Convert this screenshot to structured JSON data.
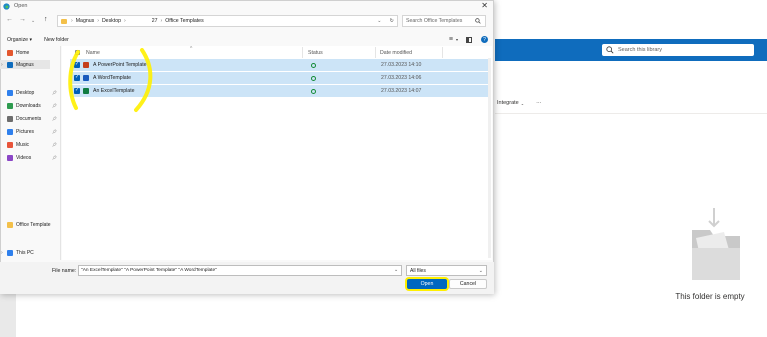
{
  "background": {
    "search_placeholder": "Search this library",
    "command_integrate": "Integrate",
    "command_more": "···",
    "empty_text": "This folder is empty"
  },
  "dialog": {
    "title": "Open",
    "close_glyph": "✕",
    "breadcrumb": [
      "Magnus",
      "Desktop",
      "27",
      "Office Templates"
    ],
    "search_placeholder": "Search Office Templates",
    "toolbar": {
      "organize": "Organize ▾",
      "new_folder": "New folder"
    },
    "nav_items": [
      {
        "label": "Home",
        "icon": "home-icon",
        "color": "#e4572e"
      },
      {
        "label": "Magnus",
        "icon": "onedrive-icon",
        "color": "#0f6cbd"
      },
      {
        "label": "Desktop",
        "icon": "desktop-icon",
        "color": "#2f80ed"
      },
      {
        "label": "Downloads",
        "icon": "download-icon",
        "color": "#2e9b4f"
      },
      {
        "label": "Documents",
        "icon": "documents-icon",
        "color": "#6d6d6d"
      },
      {
        "label": "Pictures",
        "icon": "pictures-icon",
        "color": "#2f80ed"
      },
      {
        "label": "Music",
        "icon": "music-icon",
        "color": "#e8543a"
      },
      {
        "label": "Videos",
        "icon": "videos-icon",
        "color": "#8b46c6"
      },
      {
        "label": "Office Template",
        "icon": "folder-icon",
        "color": "#f3c04a"
      },
      {
        "label": "This PC",
        "icon": "pc-icon",
        "color": "#2f80ed"
      }
    ],
    "columns": {
      "name": "Name",
      "status": "Status",
      "date": "Date modified"
    },
    "files": [
      {
        "name": "A PowerPoint Template",
        "icon": "powerpoint-icon",
        "color": "#c43e1c",
        "date": "27.03.2023 14:10"
      },
      {
        "name": "A WordTemplate",
        "icon": "word-icon",
        "color": "#185abd",
        "date": "27.03.2023 14:06"
      },
      {
        "name": "An ExcelTemplate",
        "icon": "excel-icon",
        "color": "#107c41",
        "date": "27.03.2023 14:07"
      }
    ],
    "file_name_label": "File name:",
    "file_name_value": "\"An ExcelTemplate\" \"A PowerPoint Template\" \"A WordTemplate\"",
    "file_type": "All files",
    "open_label": "Open",
    "cancel_label": "Cancel"
  },
  "colors": {
    "accent": "#0067c0",
    "selection": "#cce4f7",
    "highlight": "#ffef00"
  }
}
